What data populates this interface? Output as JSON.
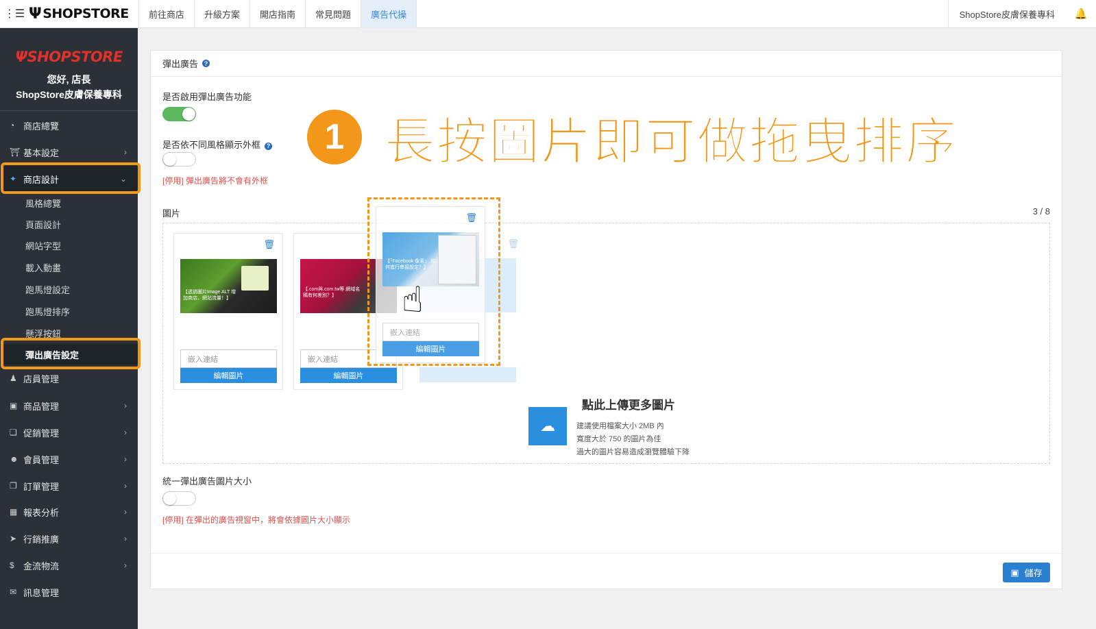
{
  "topbar": {
    "brand": "SHOPSTORE",
    "nav": [
      "前往商店",
      "升級方案",
      "開店指南",
      "常見問題",
      "廣告代操"
    ],
    "store_name": "ShopStore皮膚保養專科"
  },
  "sidebar": {
    "logo": "SHOPSTORE",
    "greeting": "您好, 店長",
    "store": "ShopStore皮膚保養專科",
    "items": [
      {
        "label": "商店總覽",
        "icon": "dashboard-icon"
      },
      {
        "label": "基本設定",
        "icon": "bank-icon"
      },
      {
        "label": "商店設計",
        "icon": "magic-wand-icon"
      },
      {
        "label": "店員管理",
        "icon": "user-icon"
      },
      {
        "label": "商品管理",
        "icon": "cart-icon"
      },
      {
        "label": "促銷管理",
        "icon": "gift-icon"
      },
      {
        "label": "會員管理",
        "icon": "users-icon"
      },
      {
        "label": "訂單管理",
        "icon": "copy-icon"
      },
      {
        "label": "報表分析",
        "icon": "bar-chart-icon"
      },
      {
        "label": "行銷推廣",
        "icon": "bullhorn-icon"
      },
      {
        "label": "金流物流",
        "icon": "dollar-icon"
      },
      {
        "label": "訊息管理",
        "icon": "comments-icon"
      }
    ],
    "sub_items": [
      "風格總覽",
      "頁面設計",
      "網站字型",
      "載入動畫",
      "跑馬燈設定",
      "跑馬燈排序",
      "懸浮按鈕",
      "彈出廣告設定"
    ]
  },
  "panel": {
    "title": "彈出廣告",
    "enable_label": "是否啟用彈出廣告功能",
    "frame_label": "是否依不同風格顯示外框",
    "frame_warn": "[停用] 彈出廣告將不會有外框",
    "images_label": "圖片",
    "counter": "3 / 8",
    "cards": [
      {
        "text": "【透過圖片Image ALT 增加商店、網站流量！】",
        "input_placeholder": "嵌入連結",
        "button": "編輯圖片"
      },
      {
        "text": "【.com與.com.tw等 網域名稱有何差別？】",
        "input_placeholder": "嵌入連結",
        "button": "編輯圖片"
      },
      {
        "text": "【「Facebook 像素」 如何進行串接設定？】",
        "input_placeholder": "嵌入連結",
        "button": "編輯圖片"
      }
    ],
    "upload_title": "點此上傳更多圖片",
    "upload_notes": [
      "建議使用檔案大小 2MB 內",
      "寬度大於 750 的圖片為佳",
      "過大的圖片容易造成瀏覽體驗下降"
    ],
    "uniform_label": "統一彈出廣告圖片大小",
    "uniform_warn": "[停用] 在彈出的廣告視窗中，將會依據圖片大小顯示",
    "save": "儲存"
  },
  "annotation": {
    "number": "1",
    "text": "長按圖片即可做拖曳排序"
  },
  "colors": {
    "accent": "#f29718",
    "primary": "#2b8fe0",
    "sidebar": "#2b3137",
    "danger": "#d9534f",
    "toggle_on": "#5cb85c"
  }
}
